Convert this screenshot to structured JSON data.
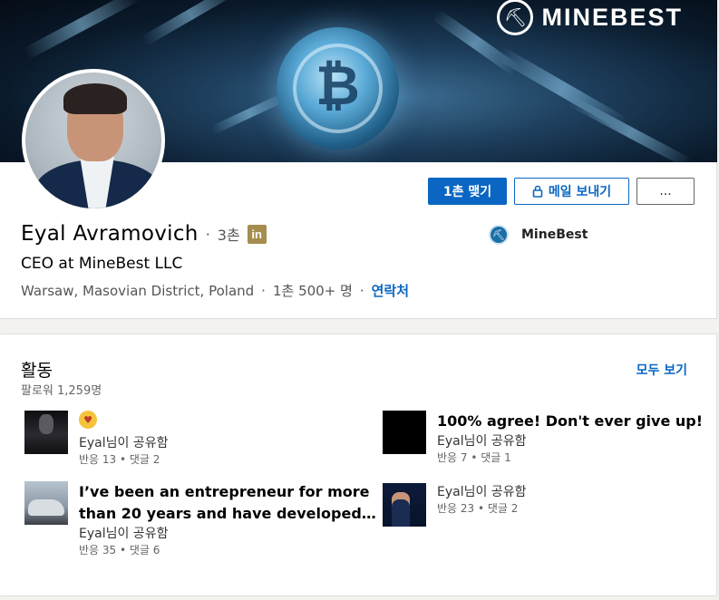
{
  "banner": {
    "brand_name": "MINEBEST",
    "brand_icon": "pickaxe-icon",
    "coin_symbol": "₿"
  },
  "profile": {
    "name": "Eyal Avramovich",
    "separator": "·",
    "degree": "3촌",
    "premium_badge": "in",
    "headline": "CEO at MineBest LLC",
    "location": "Warsaw, Masovian District, Poland",
    "connections": "1촌 500+ 명",
    "contact_link": "연락처",
    "company": {
      "name": "MineBest",
      "icon": "minebest-logo-icon"
    }
  },
  "actions": {
    "connect_label": "1촌 맺기",
    "message_label": "메일 보내기",
    "message_icon": "lock-icon",
    "more_label": "..."
  },
  "activity": {
    "title": "활동",
    "followers": "팔로워 1,259명",
    "see_all": "모두 보기",
    "posts": [
      {
        "text": "",
        "emoji": "😍",
        "shared_by": "Eyal님이 공유함",
        "stats": "반응 13 • 댓글 2"
      },
      {
        "text": "100% agree! Don't ever give up!",
        "shared_by": "Eyal님이 공유함",
        "stats": "반응 7 • 댓글 1"
      },
      {
        "text_line1": "I’ve been an entrepreneur for more",
        "text_line2": "than 20 years and have developed…",
        "shared_by": "Eyal님이 공유함",
        "stats": "반응 35 • 댓글 6"
      },
      {
        "text": "",
        "shared_by": "Eyal님이 공유함",
        "stats": "반응 23 • 댓글 2"
      }
    ]
  },
  "colors": {
    "primary": "#0a66c2",
    "premium_gold": "#a58d4e",
    "background": "#f3f2ef"
  }
}
